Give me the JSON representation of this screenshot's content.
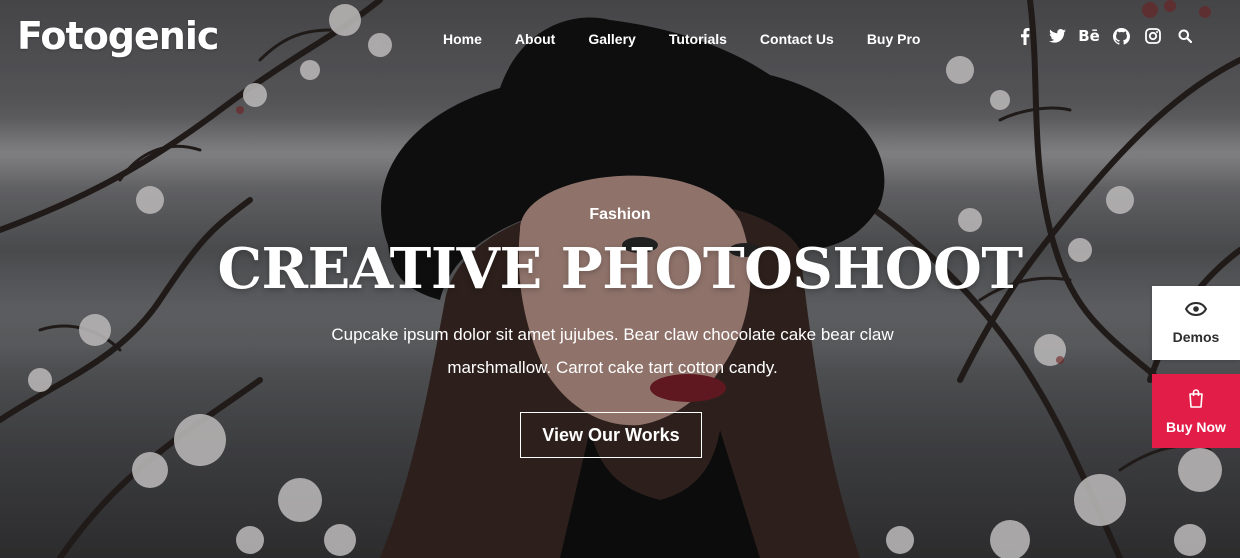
{
  "header": {
    "logo": "Fotogenic",
    "nav": [
      "Home",
      "About",
      "Gallery",
      "Tutorials",
      "Contact Us",
      "Buy Pro"
    ],
    "social_icons": [
      "facebook-icon",
      "twitter-icon",
      "behance-icon",
      "github-icon",
      "instagram-icon",
      "search-icon"
    ],
    "behance_glyph": "Bē"
  },
  "hero": {
    "eyebrow": "Fashion",
    "title": "CREATIVE PHOTOSHOOT",
    "description": "Cupcake ipsum dolor sit amet jujubes. Bear claw chocolate cake bear claw marshmallow. Carrot cake tart cotton candy.",
    "cta_label": "View Our Works"
  },
  "side_widgets": {
    "demos_label": "Demos",
    "buy_now_label": "Buy Now"
  },
  "colors": {
    "accent": "#e11d48",
    "text_on_image": "#ffffff"
  }
}
